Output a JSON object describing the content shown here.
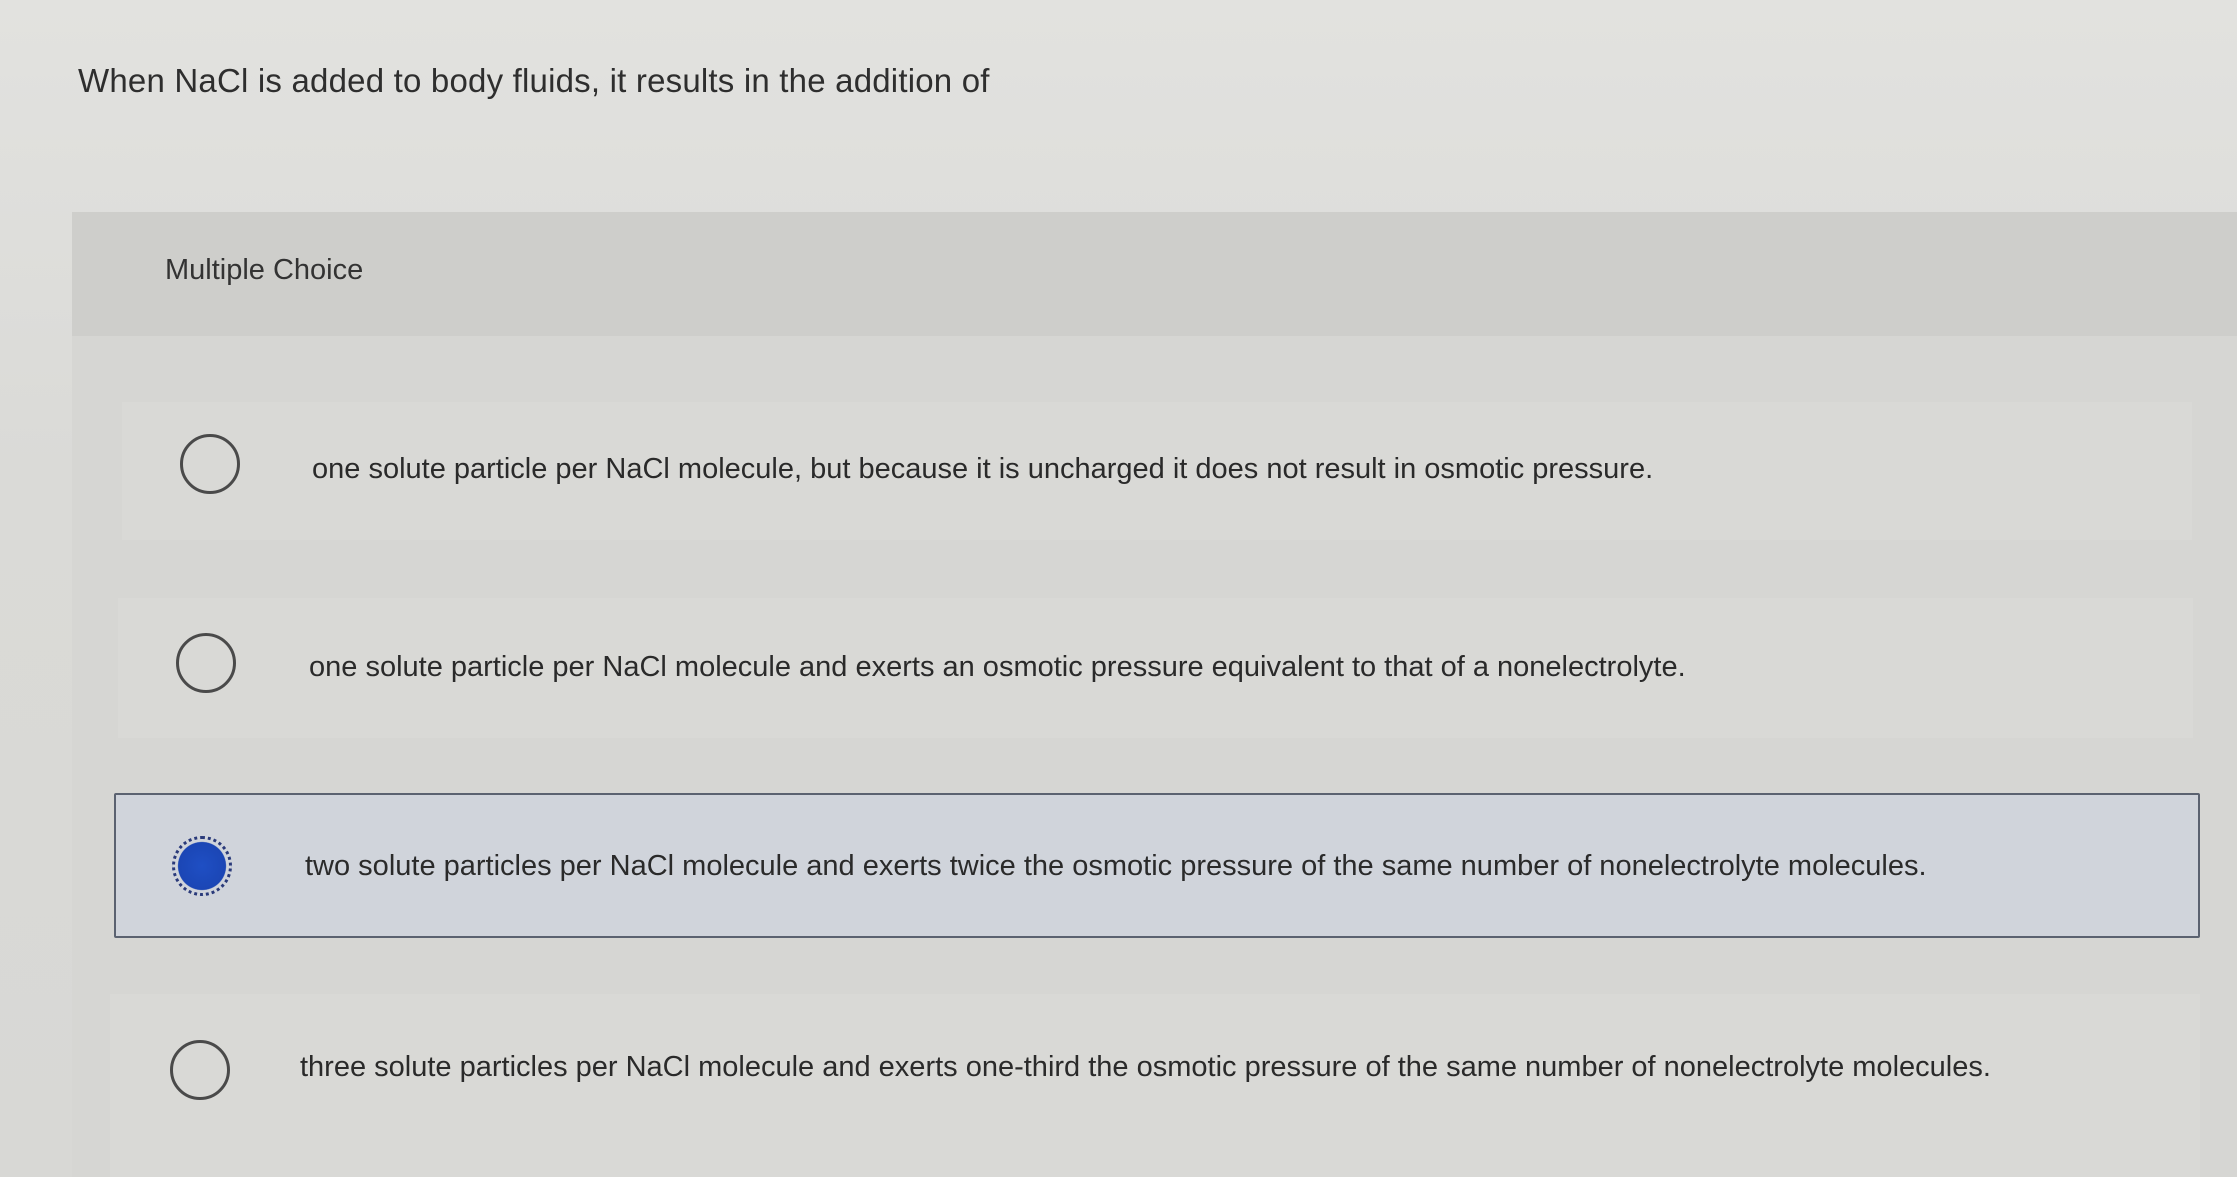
{
  "question": {
    "text": "When NaCl is added to body fluids, it results in the addition of"
  },
  "multiple_choice": {
    "label": "Multiple Choice",
    "options": [
      {
        "text": "one solute particle per NaCl molecule, but because it is uncharged it does not result in osmotic pressure.",
        "selected": false
      },
      {
        "text": "one solute particle per NaCl molecule and exerts an osmotic pressure equivalent to that of a nonelectrolyte.",
        "selected": false
      },
      {
        "text": "two solute particles per NaCl molecule and exerts twice the osmotic pressure of the same number of nonelectrolyte molecules.",
        "selected": true
      },
      {
        "text": "three solute particles per NaCl molecule and exerts one-third the osmotic pressure of the same number of nonelectrolyte molecules.",
        "selected": false
      }
    ]
  },
  "colors": {
    "selected_radio": "#1f4fc4",
    "selected_border": "#5b6270"
  }
}
